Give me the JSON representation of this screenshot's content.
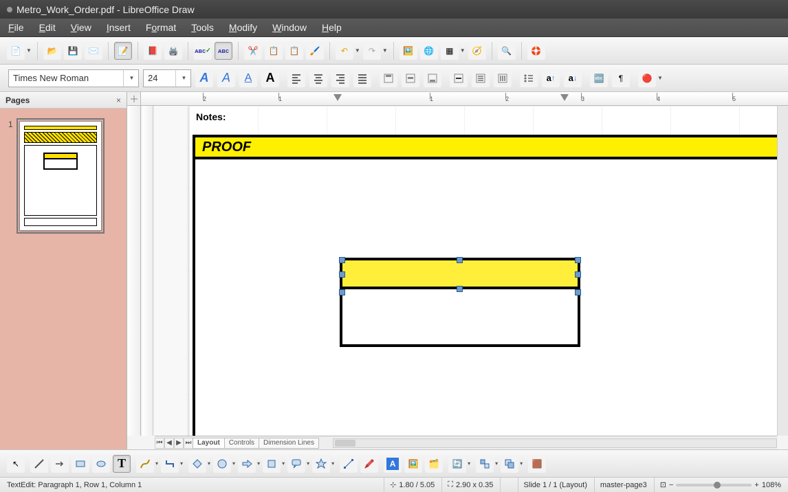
{
  "titlebar": {
    "title": "Metro_Work_Order.pdf - LibreOffice Draw"
  },
  "menubar": {
    "items": [
      "File",
      "Edit",
      "View",
      "Insert",
      "Format",
      "Tools",
      "Modify",
      "Window",
      "Help"
    ]
  },
  "font": {
    "name": "Times New Roman",
    "size": "24"
  },
  "pages_panel": {
    "title": "Pages",
    "thumb_number": "1"
  },
  "canvas": {
    "notes_label": "Notes:",
    "proof_label": "PROOF",
    "tabs": [
      "Layout",
      "Controls",
      "Dimension Lines"
    ],
    "ruler_numbers": [
      "2",
      "1",
      "1",
      "2",
      "3",
      "4",
      "5"
    ]
  },
  "status": {
    "edit": "TextEdit: Paragraph 1, Row 1, Column 1",
    "pos": "1.80 / 5.05",
    "size": "2.90 x 0.35",
    "slide": "Slide 1 / 1 (Layout)",
    "master": "master-page3",
    "zoom": "108%"
  }
}
